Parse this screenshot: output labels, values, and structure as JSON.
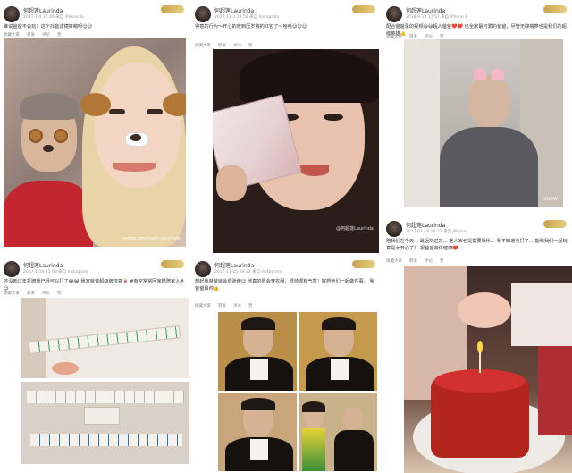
{
  "posts": [
    {
      "username": "何超莲Laurinda",
      "meta": "2017-1-4 17:46 来自 iPhone 6s",
      "text": "谁说爸爸不会玩？这个抖音滤镜好萌呀😊😊",
      "actions": [
        "收藏大家",
        "转发",
        "评论",
        "赞"
      ],
      "watermark": "weibo.com/hochulaurinda"
    },
    {
      "username": "何超莲Laurinda",
      "meta": "2017-12-3 23:58 来自 Instagram",
      "text": "得意的行为～开心的收到压岁钱的红包了～哈哈😊😊😊",
      "actions": [
        "收藏大家",
        "转发",
        "评论",
        "赞"
      ],
      "watermark": "@何超莲Laurinda"
    },
    {
      "username": "何超莲Laurinda",
      "meta": "2018-8-13 17:57 来自 iPhone 8",
      "text": "配合爸爸录的视频😄😄超人爸爸❤️❤️ 也全家最可爱的爸爸，尽管无聊搞笑也是我们的超级英雄👍",
      "actions": [
        "收藏大家",
        "转发",
        "评论",
        "赞"
      ],
      "watermark": "SNOW"
    },
    {
      "username": "何超莲Laurinda",
      "meta": "2017-01-19 19:22 来自 iPhone",
      "text": "陪我们在今天... 最近常进来... 老人家也是需要娱乐... 我不知道与打了... 能和我们一起玩真是太开心了！ 祝爸爸身体健康❤️",
      "actions": [
        "收藏大家",
        "转发",
        "评论",
        "赞"
      ],
      "watermark": ""
    },
    {
      "username": "何超莲Laurinda",
      "meta": "2017-1-19 21:08 来自 Instagram",
      "text": "还没到过年打牌我已经可以打了😂😂 我家爸爸超级牌技高🀄 #有空常常回家陪陪家人# 😊",
      "actions": [
        "收藏大家",
        "转发",
        "评论",
        "赞"
      ],
      "watermark": ""
    },
    {
      "username": "何超莲Laurinda",
      "meta": "2017-11-15 19:32 来自 Instagram",
      "text": "想起我爸爸就会很骄傲😊 他真的很会穿衣服，很帅很有气质！好想他们一起做件事。 我爸爸最帅👍",
      "actions": [
        "收藏大家",
        "转发",
        "评论",
        "赞"
      ],
      "watermark": "@何超莲Laurinda"
    }
  ]
}
